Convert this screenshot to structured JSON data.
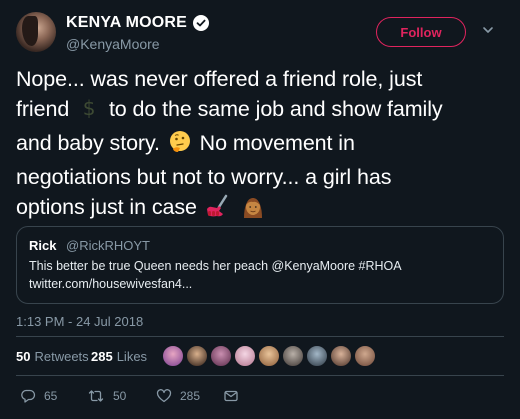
{
  "user": {
    "display_name": "KENYA MOORE",
    "handle": "@KenyaMoore"
  },
  "header": {
    "follow_label": "Follow"
  },
  "tweet": {
    "line1": "Nope... was never offered a friend role, just",
    "line2a": "friend",
    "line2b": "to do the same job and show family",
    "line3a": "and baby story.",
    "line3b": "No movement in",
    "line4": "negotiations but not to worry... a girl has",
    "line5": "options just in case"
  },
  "quote": {
    "name": "Rick",
    "handle": "@RickRHOYT",
    "text": "This better be true Queen needs her peach @KenyaMoore #RHOA",
    "link": "twitter.com/housewivesfan4..."
  },
  "timestamp": "1:13 PM - 24 Jul 2018",
  "stats": {
    "retweets_count": "50",
    "retweets_label": "Retweets",
    "likes_count": "285",
    "likes_label": "Likes"
  },
  "actions": {
    "reply_count": "65",
    "retweet_count": "50",
    "like_count": "285"
  },
  "colors": {
    "background": "#10171e",
    "follow": "#e0245e",
    "muted": "#8899a6",
    "border": "#38444d"
  },
  "icons": [
    "verified-badge-icon",
    "chevron-down-icon",
    "money-bag-icon",
    "thinking-face-icon",
    "nail-polish-icon",
    "woman-icon",
    "reply-icon",
    "retweet-icon",
    "heart-icon",
    "mail-icon"
  ]
}
